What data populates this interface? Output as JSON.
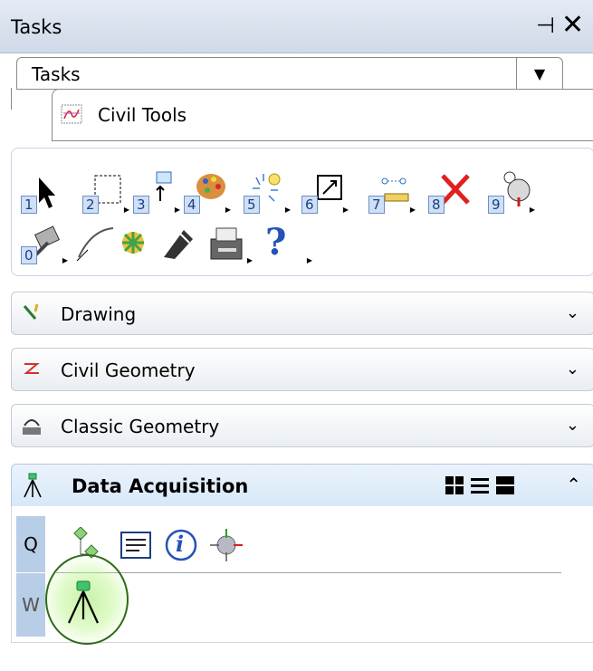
{
  "window": {
    "title": "Tasks",
    "pin_glyph": "⊣",
    "close_glyph": "✕"
  },
  "tasks_combo": {
    "selected": "Tasks",
    "dropdown_glyph": "▼"
  },
  "civil_tools": {
    "label": "Civil Tools",
    "icon": "civil-tools-icon"
  },
  "toolbox": {
    "tools": [
      {
        "num": "1",
        "icon": "select-arrow-icon"
      },
      {
        "num": "2",
        "icon": "fence-icon"
      },
      {
        "num": "3",
        "icon": "place-element-icon"
      },
      {
        "num": "4",
        "icon": "palette-icon"
      },
      {
        "num": "5",
        "icon": "spark-icon"
      },
      {
        "num": "6",
        "icon": "scale-icon"
      },
      {
        "num": "7",
        "icon": "measure-icon"
      },
      {
        "num": "8",
        "icon": "delete-icon"
      },
      {
        "num": "9",
        "icon": "settings-icon"
      },
      {
        "num": "0",
        "icon": "tools-icon"
      },
      {
        "num": "",
        "icon": "curve-icon"
      },
      {
        "num": "",
        "icon": "terrain-icon"
      },
      {
        "num": "",
        "icon": "dimension-icon"
      },
      {
        "num": "",
        "icon": "printer-icon"
      },
      {
        "num": "",
        "icon": "help-icon",
        "glyph": "?"
      }
    ]
  },
  "sections": [
    {
      "label": "Drawing",
      "icon": "drawing-icon",
      "chevron": "⌄"
    },
    {
      "label": "Civil Geometry",
      "icon": "civil-geometry-icon",
      "chevron": "⌄"
    },
    {
      "label": "Classic Geometry",
      "icon": "classic-geometry-icon",
      "chevron": "⌄"
    }
  ],
  "data_acquisition": {
    "label": "Data Acquisition",
    "icon": "survey-tripod-icon",
    "chevron": "⌃",
    "rows": [
      {
        "label": "Q",
        "tools": [
          "hierarchy-icon",
          "list-icon",
          "info-icon",
          "target-icon"
        ]
      },
      {
        "label": "W",
        "tools": [
          "survey-tripod-icon"
        ]
      }
    ],
    "info_glyph": "i"
  },
  "colors": {
    "highlight": "#aeea80",
    "circle": "#2f6b16",
    "accent": "#1a3f85"
  }
}
